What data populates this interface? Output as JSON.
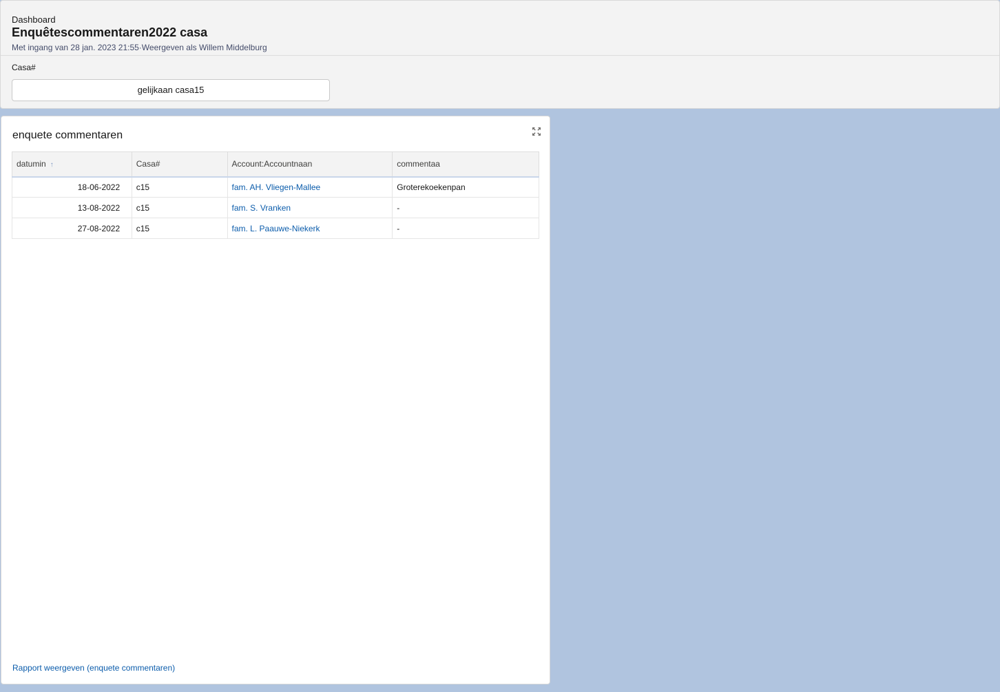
{
  "header": {
    "eyebrow": "Dashboard",
    "title": "Enquêtescommentaren2022 casa",
    "subtitle": "Met ingang van 28 jan. 2023 21:55·Weergeven als Willem Middelburg"
  },
  "filter": {
    "label": "Casa#",
    "value": "gelijkaan casa15"
  },
  "panel": {
    "title": "enquete commentaren",
    "expand_icon": "expand-arrows-icon",
    "footer_link": "Rapport weergeven (enquete commentaren)"
  },
  "table": {
    "columns": [
      "datumin",
      "Casa#",
      "Account:Accountnaan",
      "commentaa"
    ],
    "sort_icon": "arrow-up-icon",
    "rows": [
      {
        "date": "18-06-2022",
        "casa": "c15",
        "account": "fam. AH. Vliegen-Mallee",
        "comment": "Groterekoekenpan"
      },
      {
        "date": "13-08-2022",
        "casa": "c15",
        "account": "fam. S. Vranken",
        "comment": "-"
      },
      {
        "date": "27-08-2022",
        "casa": "c15",
        "account": "fam. L. Paauwe-Niekerk",
        "comment": "-"
      }
    ]
  },
  "colors": {
    "background": "#b0c4df",
    "link": "#0b5cab",
    "header_bg": "#f3f3f3"
  }
}
